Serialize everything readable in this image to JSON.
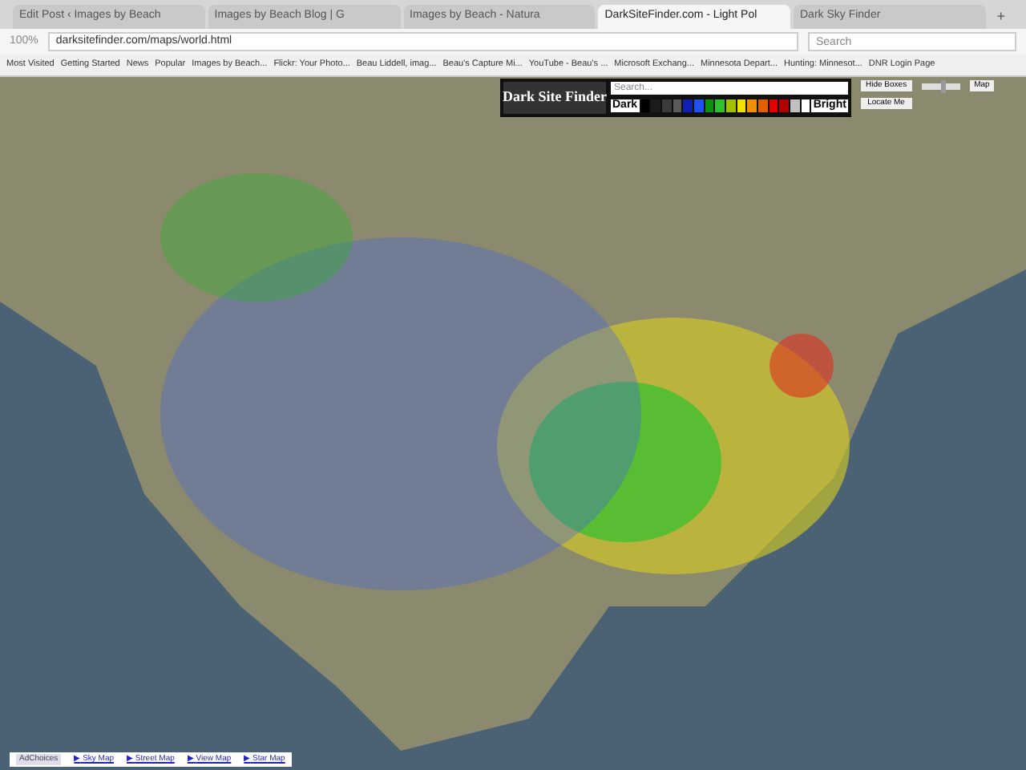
{
  "tabs": [
    {
      "label": "Edit Post ‹ Images by Beach",
      "selected": false
    },
    {
      "label": "Images by Beach Blog | G",
      "selected": false
    },
    {
      "label": "Images by Beach - Natura",
      "selected": false
    },
    {
      "label": "DarkSiteFinder.com - Light Pol",
      "selected": true
    },
    {
      "label": "Dark Sky Finder",
      "selected": false
    }
  ],
  "new_tab": "+",
  "toolbar": {
    "zoom": "100%",
    "url": "darksitefinder.com/maps/world.html",
    "search_placeholder": "Search"
  },
  "bookmarks": [
    "Most Visited",
    "Getting Started",
    "News",
    "Popular",
    "Images by Beach...",
    "Flickr: Your Photo...",
    "Beau Liddell, imag...",
    "Beau's Capture Mi...",
    "YouTube - Beau's ...",
    "Microsoft Exchang...",
    "Minnesota Depart...",
    "Hunting: Minnesot...",
    "DNR Login Page"
  ],
  "overlay": {
    "logo": "Dark Site Finder",
    "search_placeholder": "Search...",
    "legend_low": "Dark",
    "legend_high": "Bright",
    "legend": [
      {
        "color": "#000000"
      },
      {
        "color": "#1c1c1c"
      },
      {
        "color": "#3a3a3a"
      },
      {
        "color": "#5a5a5a"
      },
      {
        "color": "#1020b0"
      },
      {
        "color": "#2050f0"
      },
      {
        "color": "#109010"
      },
      {
        "color": "#30c030"
      },
      {
        "color": "#a0c000"
      },
      {
        "color": "#f0e000"
      },
      {
        "color": "#f09000"
      },
      {
        "color": "#e06000"
      },
      {
        "color": "#e00000"
      },
      {
        "color": "#b00000"
      },
      {
        "color": "#c0c0c0"
      },
      {
        "color": "#ffffff"
      }
    ],
    "hide_button": "Hide Boxes",
    "locate_button": "Locate Me",
    "map_button": "Map",
    "slider": {
      "level": 0.6
    }
  },
  "bottom_bar": {
    "ad": "AdChoices",
    "links": [
      "Sky Map",
      "Street Map",
      "View Map",
      "Star Map"
    ],
    "arrow": "▶"
  }
}
